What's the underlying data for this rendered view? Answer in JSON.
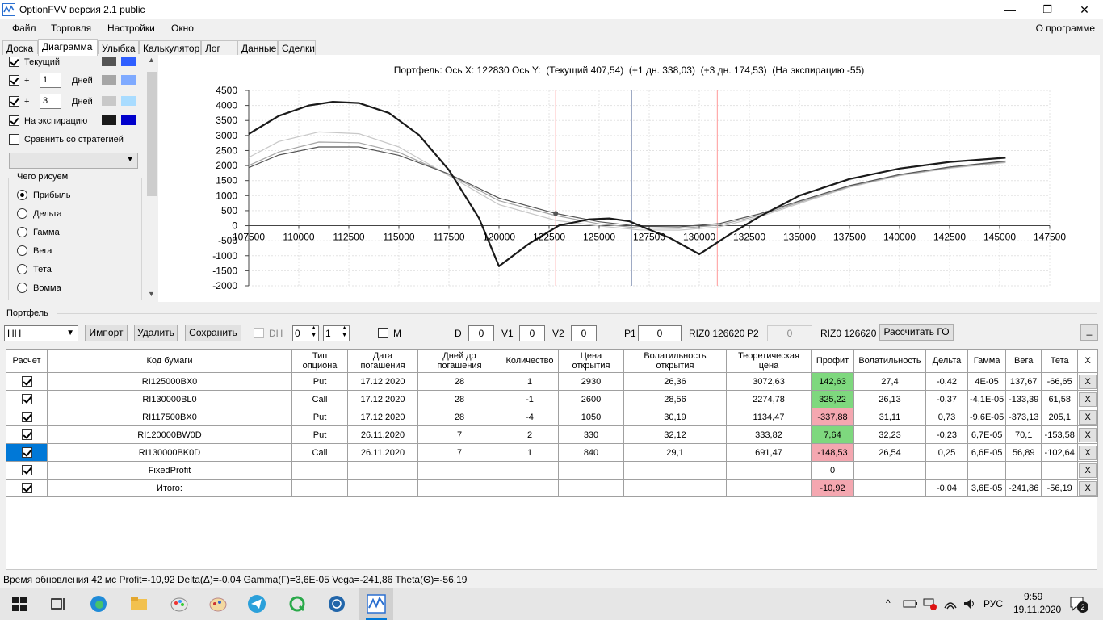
{
  "window": {
    "title": "OptionFVV версия 2.1 public",
    "minimize": "—",
    "restore": "❐",
    "close": "✕"
  },
  "menu": {
    "items": [
      "Файл",
      "Торговля",
      "Настройки",
      "Окно"
    ],
    "about": "О программе"
  },
  "tabs": [
    "Доска",
    "Диаграмма",
    "Улыбка",
    "Калькулятор",
    "Лог",
    "Данные",
    "Сделки"
  ],
  "active_tab": "Диаграмма",
  "left": {
    "current_label": "Текущий",
    "plus": "+",
    "days_label": "Дней",
    "days1": "1",
    "days3": "3",
    "expiry_label": "На экспирацию",
    "compare_label": "Сравнить со стратегией",
    "combo_value": "",
    "group_title": "Чего рисуем",
    "options": [
      "Прибыль",
      "Дельта",
      "Гамма",
      "Вега",
      "Тета",
      "Вомма"
    ],
    "selected_option": "Прибыль",
    "colors": {
      "current": [
        "#555555",
        "#2f5fff"
      ],
      "d1": [
        "#a6a6a6",
        "#7faaff"
      ],
      "d3": [
        "#c8c8c8",
        "#a9dcff"
      ],
      "expiry": [
        "#1a1a1a",
        "#0000cc"
      ]
    }
  },
  "chart_header": "Портфель: Ось X: 122830 Ось Y:  (Текущий 407,54)  (+1 дн. 338,03)  (+3 дн. 174,53)  (На экспирацию -55)",
  "chart_data": {
    "type": "line",
    "title": "",
    "xlim": [
      107500,
      147500
    ],
    "ylim": [
      -2000,
      4500
    ],
    "xticks": [
      107500,
      110000,
      112500,
      115000,
      117500,
      120000,
      122500,
      125000,
      127500,
      130000,
      132500,
      135000,
      137500,
      140000,
      142500,
      145000,
      147500
    ],
    "yticks": [
      4500,
      4000,
      3500,
      3000,
      2500,
      2000,
      1500,
      1000,
      500,
      0,
      -500,
      -1000,
      -1500,
      -2000
    ],
    "grid": true,
    "vlines": [
      {
        "x": 122830,
        "color": "#ff9a9a"
      },
      {
        "x": 126620,
        "color": "#6f82a8"
      },
      {
        "x": 130900,
        "color": "#ff9a9a"
      }
    ],
    "marker": {
      "x": 122830,
      "y": 407.54
    },
    "series": [
      {
        "color": "#1a1a1a",
        "width": 2.2,
        "x": [
          107500,
          109000,
          110500,
          111700,
          113000,
          114500,
          116000,
          117500,
          119000,
          120000,
          121500,
          123000,
          124500,
          125500,
          126500,
          127500,
          128500,
          130000,
          131500,
          133000,
          135000,
          137500,
          140000,
          142500,
          145300
        ],
        "y": [
          3050,
          3650,
          4000,
          4120,
          4080,
          3750,
          3020,
          1850,
          250,
          -1350,
          -600,
          10,
          210,
          240,
          150,
          -130,
          -400,
          -950,
          -300,
          300,
          1000,
          1550,
          1900,
          2120,
          2260
        ]
      },
      {
        "color": "#555555",
        "width": 1.2,
        "x": [
          107500,
          109000,
          111000,
          113000,
          115000,
          117500,
          120000,
          122830,
          125000,
          127000,
          129000,
          131000,
          133000,
          135000,
          137500,
          140000,
          142500,
          145300
        ],
        "y": [
          1930,
          2350,
          2620,
          2620,
          2340,
          1720,
          920,
          407.54,
          130,
          -20,
          -40,
          70,
          390,
          820,
          1330,
          1700,
          1950,
          2150
        ]
      },
      {
        "color": "#a6a6a6",
        "width": 1.2,
        "x": [
          107500,
          109000,
          111000,
          113000,
          115000,
          117500,
          120000,
          122830,
          125000,
          127000,
          129000,
          131000,
          133000,
          135000,
          137500,
          140000,
          142500,
          145300
        ],
        "y": [
          2000,
          2450,
          2780,
          2760,
          2440,
          1700,
          830,
          338.03,
          60,
          -80,
          -90,
          20,
          340,
          780,
          1300,
          1680,
          1930,
          2120
        ]
      },
      {
        "color": "#c8c8c8",
        "width": 1.2,
        "x": [
          107500,
          109000,
          111000,
          113000,
          115000,
          117500,
          120000,
          122830,
          125000,
          127000,
          129000,
          131000,
          133000,
          135000,
          137500,
          140000,
          142500,
          145300
        ],
        "y": [
          2270,
          2800,
          3120,
          3060,
          2620,
          1660,
          700,
          174.53,
          -10,
          -140,
          -150,
          -40,
          290,
          740,
          1280,
          1660,
          1910,
          2100
        ]
      }
    ]
  },
  "portfolio": {
    "label": "Портфель",
    "combo": "НН",
    "import": "Импорт",
    "delete": "Удалить",
    "save": "Сохранить",
    "dh": "DH",
    "spin_a": "0",
    "spin_b": "1",
    "m": "M",
    "d_label": "D",
    "d_val": "0",
    "v1_label": "V1",
    "v1_val": "0",
    "v2_label": "V2",
    "v2_val": "0",
    "p1_label": "P1",
    "p1_val": "0",
    "riz1": "RIZ0 126620",
    "p2_label": "P2",
    "p2_val": "0",
    "riz2": "RIZ0 126620",
    "calc_go": "Рассчитать ГО",
    "collapse": "_"
  },
  "table": {
    "headers": [
      "Расчет",
      "Код бумаги",
      "Тип опциона",
      "Дата погашения",
      "Дней до погашения",
      "Количество",
      "Цена открытия",
      "Волатильность открытия",
      "Теоретическая цена",
      "Профит",
      "Волатильность",
      "Дельта",
      "Гамма",
      "Вега",
      "Тета",
      "X"
    ],
    "rows": [
      {
        "code": "RI125000BX0",
        "type": "Put",
        "date": "17.12.2020",
        "days": "28",
        "qty": "1",
        "price": "2930",
        "vol_open": "26,36",
        "theo": "3072,63",
        "profit": "142,63",
        "vol": "27,4",
        "delta": "-0,42",
        "gamma": "4E-05",
        "vega": "137,67",
        "theta": "-66,65",
        "x": "X",
        "pc": "g",
        "sel": false
      },
      {
        "code": "RI130000BL0",
        "type": "Call",
        "date": "17.12.2020",
        "days": "28",
        "qty": "-1",
        "price": "2600",
        "vol_open": "28,56",
        "theo": "2274,78",
        "profit": "325,22",
        "vol": "26,13",
        "delta": "-0,37",
        "gamma": "-4,1E-05",
        "vega": "-133,39",
        "theta": "61,58",
        "x": "X",
        "pc": "g",
        "sel": false
      },
      {
        "code": "RI117500BX0",
        "type": "Put",
        "date": "17.12.2020",
        "days": "28",
        "qty": "-4",
        "price": "1050",
        "vol_open": "30,19",
        "theo": "1134,47",
        "profit": "-337,88",
        "vol": "31,11",
        "delta": "0,73",
        "gamma": "-9,6E-05",
        "vega": "-373,13",
        "theta": "205,1",
        "x": "X",
        "pc": "r",
        "sel": false
      },
      {
        "code": "RI120000BW0D",
        "type": "Put",
        "date": "26.11.2020",
        "days": "7",
        "qty": "2",
        "price": "330",
        "vol_open": "32,12",
        "theo": "333,82",
        "profit": "7,64",
        "vol": "32,23",
        "delta": "-0,23",
        "gamma": "6,7E-05",
        "vega": "70,1",
        "theta": "-153,58",
        "x": "X",
        "pc": "g",
        "sel": false
      },
      {
        "code": "RI130000BK0D",
        "type": "Call",
        "date": "26.11.2020",
        "days": "7",
        "qty": "1",
        "price": "840",
        "vol_open": "29,1",
        "theo": "691,47",
        "profit": "-148,53",
        "vol": "26,54",
        "delta": "0,25",
        "gamma": "6,6E-05",
        "vega": "56,89",
        "theta": "-102,64",
        "x": "X",
        "pc": "r",
        "sel": true
      },
      {
        "code": "FixedProfit",
        "type": "",
        "date": "",
        "days": "",
        "qty": "",
        "price": "",
        "vol_open": "",
        "theo": "",
        "profit": "0",
        "vol": "",
        "delta": "",
        "gamma": "",
        "vega": "",
        "theta": "",
        "x": "X",
        "pc": "",
        "sel": false
      },
      {
        "code": "Итого:",
        "type": "",
        "date": "",
        "days": "",
        "qty": "",
        "price": "",
        "vol_open": "",
        "theo": "",
        "profit": "-10,92",
        "vol": "",
        "delta": "-0,04",
        "gamma": "3,6E-05",
        "vega": "-241,86",
        "theta": "-56,19",
        "x": "X",
        "pc": "r",
        "sel": false
      }
    ]
  },
  "status": "Время обновления 42 мс  Profit=-10,92 Delta(Δ)=-0,04 Gamma(Γ)=3,6E-05 Vega=-241,86 Theta(Θ)=-56,19",
  "taskbar": {
    "lang": "РУС",
    "time": "9:59",
    "date": "19.11.2020",
    "notif": "2",
    "apps": [
      "windows-start",
      "task-view",
      "edge",
      "file-explorer",
      "paint",
      "paint-3d",
      "telegram",
      "quik",
      "network-app",
      "optionfvv"
    ]
  }
}
